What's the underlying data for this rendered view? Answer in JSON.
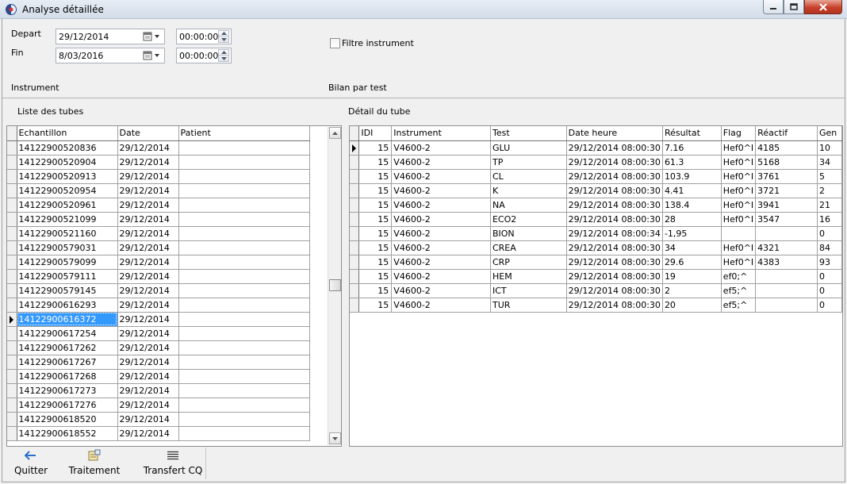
{
  "window": {
    "title": "Analyse détaillée"
  },
  "filters": {
    "depart_label": "Depart",
    "fin_label": "Fin",
    "depart_date": "29/12/2014",
    "depart_time": "00:00:00",
    "fin_date": "8/03/2016",
    "fin_time": "00:00:00",
    "filtre_instrument_label": "Filtre instrument",
    "filtre_instrument_checked": false,
    "instrument_label": "Instrument",
    "bilan_label": "Bilan par test"
  },
  "tubes": {
    "section_label": "Liste des tubes",
    "columns": [
      "Echantillon",
      "Date",
      "Patient"
    ],
    "selected_index": 12,
    "rows": [
      [
        "14122900520836",
        "29/12/2014",
        ""
      ],
      [
        "14122900520904",
        "29/12/2014",
        ""
      ],
      [
        "14122900520913",
        "29/12/2014",
        ""
      ],
      [
        "14122900520954",
        "29/12/2014",
        ""
      ],
      [
        "14122900520961",
        "29/12/2014",
        ""
      ],
      [
        "14122900521099",
        "29/12/2014",
        ""
      ],
      [
        "14122900521160",
        "29/12/2014",
        ""
      ],
      [
        "14122900579031",
        "29/12/2014",
        ""
      ],
      [
        "14122900579099",
        "29/12/2014",
        ""
      ],
      [
        "14122900579111",
        "29/12/2014",
        ""
      ],
      [
        "14122900579145",
        "29/12/2014",
        ""
      ],
      [
        "14122900616293",
        "29/12/2014",
        ""
      ],
      [
        "14122900616372",
        "29/12/2014",
        ""
      ],
      [
        "14122900617254",
        "29/12/2014",
        ""
      ],
      [
        "14122900617262",
        "29/12/2014",
        ""
      ],
      [
        "14122900617267",
        "29/12/2014",
        ""
      ],
      [
        "14122900617268",
        "29/12/2014",
        ""
      ],
      [
        "14122900617273",
        "29/12/2014",
        ""
      ],
      [
        "14122900617276",
        "29/12/2014",
        ""
      ],
      [
        "14122900618520",
        "29/12/2014",
        ""
      ],
      [
        "14122900618552",
        "29/12/2014",
        ""
      ]
    ]
  },
  "detail": {
    "section_label": "Détail du tube",
    "columns": [
      "IDI",
      "Instrument",
      "Test",
      "Date heure",
      "Résultat",
      "Flag",
      "Réactif",
      "Gen"
    ],
    "current_index": 0,
    "rows": [
      [
        "15",
        "V4600-2",
        "GLU",
        "29/12/2014 08:00:30",
        "7.16",
        "Hef0^I",
        "4185",
        "10"
      ],
      [
        "15",
        "V4600-2",
        "TP",
        "29/12/2014 08:00:30",
        "61.3",
        "Hef0^I",
        "5168",
        "34"
      ],
      [
        "15",
        "V4600-2",
        "CL",
        "29/12/2014 08:00:30",
        "103.9",
        "Hef0^I",
        "3761",
        "5"
      ],
      [
        "15",
        "V4600-2",
        "K",
        "29/12/2014 08:00:30",
        "4.41",
        "Hef0^I",
        "3721",
        "2"
      ],
      [
        "15",
        "V4600-2",
        "NA",
        "29/12/2014 08:00:30",
        "138.4",
        "Hef0^I",
        "3941",
        "21"
      ],
      [
        "15",
        "V4600-2",
        "ECO2",
        "29/12/2014 08:00:30",
        "28",
        "Hef0^I",
        "3547",
        "16"
      ],
      [
        "15",
        "V4600-2",
        "BION",
        "29/12/2014 08:00:34",
        "-1,95",
        "",
        "",
        "0"
      ],
      [
        "15",
        "V4600-2",
        "CREA",
        "29/12/2014 08:00:30",
        "34",
        "Hef0^I",
        "4321",
        "84"
      ],
      [
        "15",
        "V4600-2",
        "CRP",
        "29/12/2014 08:00:30",
        "29.6",
        "Hef0^I",
        "4383",
        "93"
      ],
      [
        "15",
        "V4600-2",
        "HEM",
        "29/12/2014 08:00:30",
        "19",
        "ef0;^",
        "",
        "0"
      ],
      [
        "15",
        "V4600-2",
        "ICT",
        "29/12/2014 08:00:30",
        "2",
        "ef5;^",
        "",
        "0"
      ],
      [
        "15",
        "V4600-2",
        "TUR",
        "29/12/2014 08:00:30",
        "20",
        "ef5;^",
        "",
        "0"
      ]
    ]
  },
  "toolbar": {
    "quitter_label": "Quitter",
    "traitement_label": "Traitement",
    "transfert_label": "Transfert CQ"
  },
  "icons": {
    "app": "app-logo-icon",
    "quitter": "back-arrow-icon",
    "traitement": "process-icon",
    "transfert": "list-icon"
  },
  "colors": {
    "selection": "#3399ff",
    "close_button": "#c7422b"
  }
}
